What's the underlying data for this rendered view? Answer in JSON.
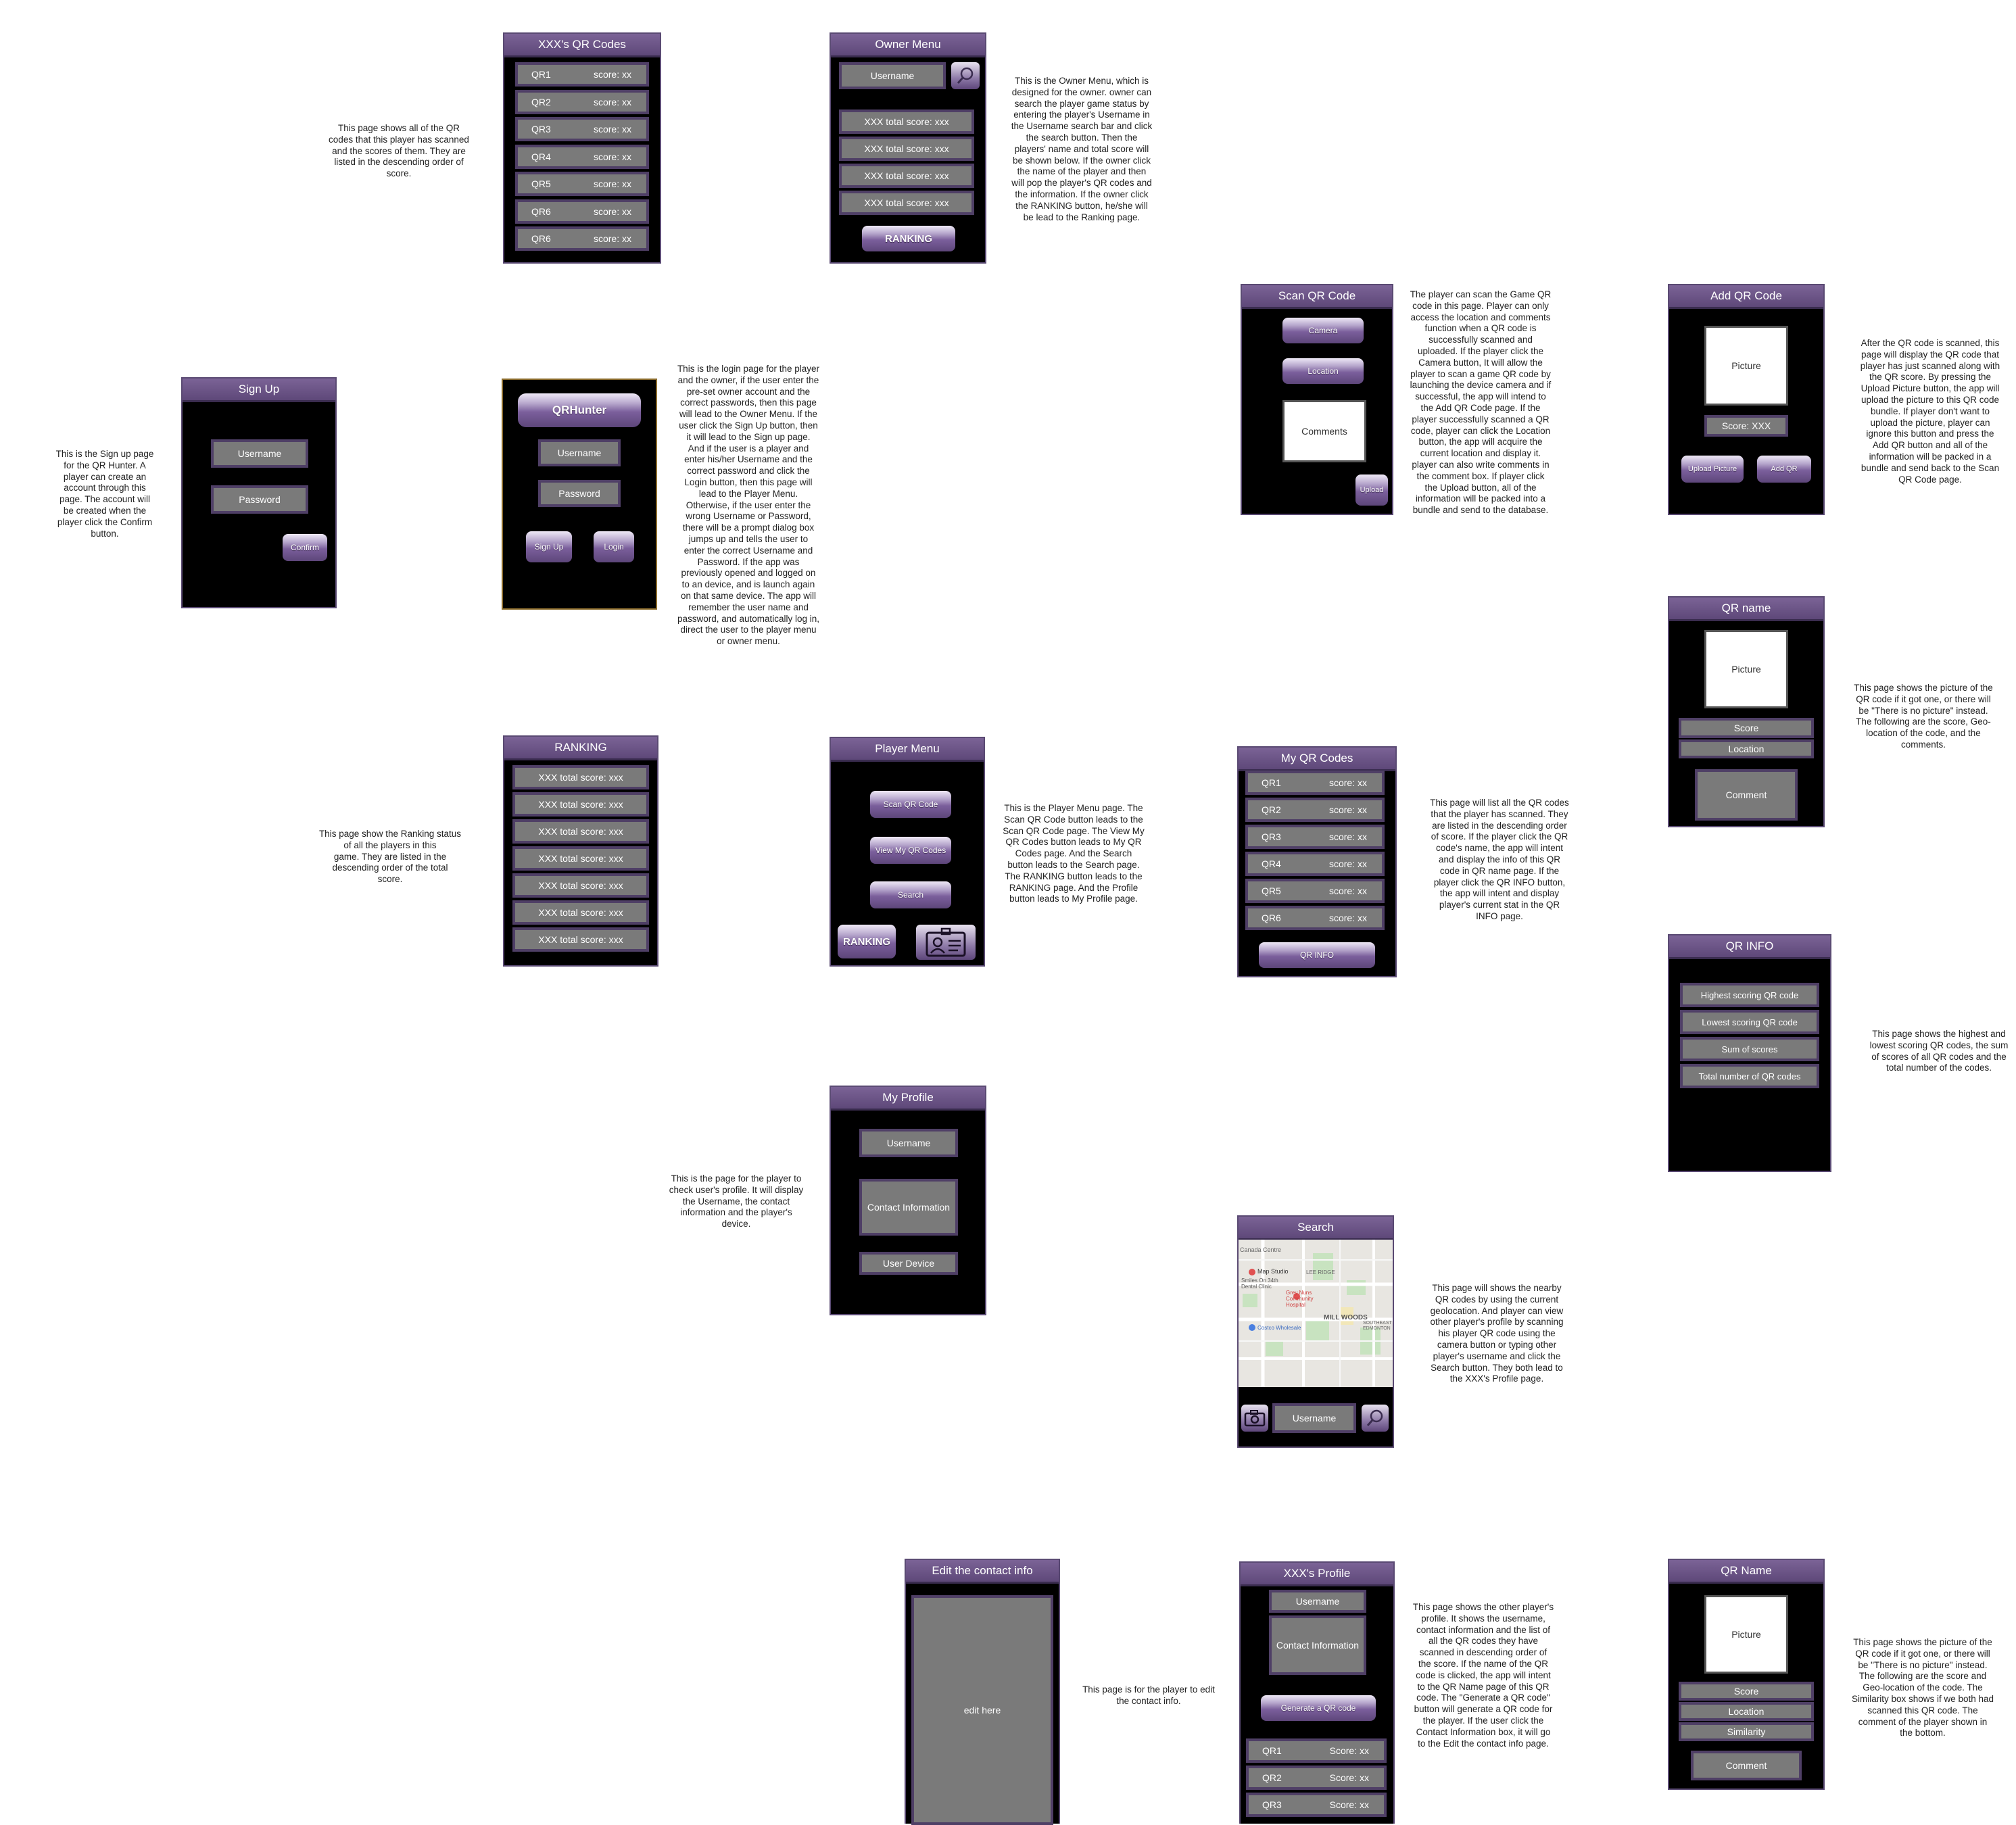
{
  "screens": {
    "qr_codes_list": {
      "title": "XXX's QR Codes",
      "rows": [
        {
          "name": "QR1",
          "score": "score: xx"
        },
        {
          "name": "QR2",
          "score": "score: xx"
        },
        {
          "name": "QR3",
          "score": "score: xx"
        },
        {
          "name": "QR4",
          "score": "score: xx"
        },
        {
          "name": "QR5",
          "score": "score: xx"
        },
        {
          "name": "QR6",
          "score": "score: xx"
        },
        {
          "name": "QR6",
          "score": "score: xx"
        }
      ]
    },
    "owner_menu": {
      "title": "Owner Menu",
      "username": "Username",
      "rows": [
        "XXX total score: xxx",
        "XXX total score: xxx",
        "XXX total score: xxx",
        "XXX total score: xxx"
      ],
      "ranking": "RANKING"
    },
    "sign_up": {
      "title": "Sign Up",
      "username": "Username",
      "password": "Password",
      "confirm": "Confirm"
    },
    "login": {
      "app": "QRHunter",
      "username": "Username",
      "password": "Password",
      "sign_up": "Sign Up",
      "login": "Login"
    },
    "scan_qr": {
      "title": "Scan QR Code",
      "camera": "Camera",
      "location": "Location",
      "comments": "Comments",
      "upload": "Upload"
    },
    "add_qr": {
      "title": "Add QR Code",
      "picture": "Picture",
      "score": "Score: XXX",
      "upload_picture": "Upload Picture",
      "add_qr": "Add QR"
    },
    "qr_name": {
      "title": "QR name",
      "picture": "Picture",
      "score": "Score",
      "location": "Location",
      "comment": "Comment"
    },
    "ranking": {
      "title": "RANKING",
      "rows": [
        "XXX total score: xxx",
        "XXX total score: xxx",
        "XXX total score: xxx",
        "XXX total score: xxx",
        "XXX total score: xxx",
        "XXX total score: xxx",
        "XXX total score: xxx"
      ]
    },
    "player_menu": {
      "title": "Player Menu",
      "scan": "Scan QR Code",
      "view": "View My QR Codes",
      "search": "Search",
      "ranking": "RANKING"
    },
    "my_qr_codes": {
      "title": "My QR Codes",
      "rows": [
        {
          "name": "QR1",
          "score": "score: xx"
        },
        {
          "name": "QR2",
          "score": "score: xx"
        },
        {
          "name": "QR3",
          "score": "score: xx"
        },
        {
          "name": "QR4",
          "score": "score: xx"
        },
        {
          "name": "QR5",
          "score": "score: xx"
        },
        {
          "name": "QR6",
          "score": "score: xx"
        }
      ],
      "qr_info": "QR INFO"
    },
    "qr_info": {
      "title": "QR INFO",
      "rows": [
        "Highest scoring QR code",
        "Lowest scoring QR code",
        "Sum of scores",
        "Total number of QR codes"
      ]
    },
    "my_profile": {
      "title": "My Profile",
      "username": "Username",
      "contact": "Contact Information",
      "device": "User Device"
    },
    "search": {
      "title": "Search",
      "username": "Username",
      "map_labels": [
        "Canada Centre",
        "Map Studio",
        "Smiles On 34th Dental Clinic",
        "LEE RIDGE",
        "Grey Nuns Community Hospital",
        "MILL WOODS",
        "SOUTHEAST EDMONTON",
        "Costco Wholesale"
      ]
    },
    "edit_contact": {
      "title": "Edit the contact info",
      "edit": "edit here"
    },
    "xxx_profile": {
      "title": "XXX's Profile",
      "username": "Username",
      "contact": "Contact Information",
      "generate": "Generate a QR code",
      "rows": [
        {
          "name": "QR1",
          "score": "Score: xx"
        },
        {
          "name": "QR2",
          "score": "Score: xx"
        },
        {
          "name": "QR3",
          "score": "Score: xx"
        }
      ]
    },
    "qr_name2": {
      "title": "QR Name",
      "picture": "Picture",
      "score": "Score",
      "location": "Location",
      "similarity": "Similarity",
      "comment": "Comment"
    }
  },
  "descriptions": {
    "qr_codes_list": [
      "This page shows all of the QR",
      "codes that this player has scanned",
      "and the scores of them. They are",
      "listed in the descending order of",
      "score."
    ],
    "owner_menu": [
      "This is the Owner Menu, which is",
      "designed for the owner. owner can",
      "search the player game status by",
      "entering the player's Username in",
      "the Username search bar and click",
      "the search button. Then the",
      "players' name and total score will",
      "be shown below. If the owner click",
      "the name of the player and then",
      "will pop the player's QR codes and",
      "the information. If the owner click",
      "the RANKING button, he/she will",
      "be lead to the Ranking page."
    ],
    "sign_up": [
      "This is the Sign up page",
      "for the QR Hunter. A",
      "player can create an",
      "account through this",
      "page. The account will",
      "be created when the",
      "player click the Confirm",
      "button."
    ],
    "login": [
      "This is the login page for the player",
      "and the owner, if the user enter the",
      "pre-set owner account and the",
      "correct passwords, then this page",
      "will lead to the Owner Menu. If the",
      "user click the Sign Up button,  then",
      "it will lead to the Sign up page.",
      "And if the user is a player and",
      "enter his/her Username  and the",
      "correct password and click the",
      "Login button, then this page will",
      "lead to the Player Menu.",
      "Otherwise, if the user enter the",
      "wrong Username or Password,",
      "there will be a prompt dialog box",
      "jumps up and tells the user to",
      "enter the correct Username and",
      "Password. If the app was",
      "previously opened and logged on",
      "to an device, and is launch again",
      "on that same device. The app will",
      "remember the user name and",
      "password, and automatically log in,",
      "direct the user to the player menu",
      "or owner menu."
    ],
    "scan_qr": [
      "The player can scan the Game QR",
      "code in this page. Player can only",
      "access the location and comments",
      "function when a QR code is",
      "successfully scanned and",
      "uploaded. If the player click the",
      "Camera button, It will allow the",
      "player to scan a game QR code by",
      "launching the device camera and if",
      "successful, the app will intend to",
      "the Add QR Code page. If the",
      "player successfully scanned a QR",
      "code,  player can click the Location",
      "button, the app will acquire the",
      "current location and display it.",
      "player can also write comments in",
      "the comment box. If player click",
      "the Upload button, all of the",
      "information will be packed into a",
      "bundle and send to the database."
    ],
    "add_qr": [
      "After the QR code is scanned, this",
      "page will display the QR code that",
      "player has just scanned along with",
      "the QR score. By pressing the",
      "Upload Picture button, the app will",
      "upload the picture to this QR code",
      "bundle. If player don't want to",
      "upload the picture, player can",
      "ignore this button and press the",
      "Add QR button and all of the",
      "information will be packed in a",
      "bundle and send back to the Scan",
      "QR Code page."
    ],
    "qr_name": [
      "This page shows the picture of the",
      "QR code if it got one, or there will",
      "be \"There is no picture\" instead.",
      "The following are the score, Geo-",
      "location of the code, and the",
      "comments."
    ],
    "ranking": [
      "This page show the Ranking status",
      "of all the players in this",
      "game. They are listed in the",
      "descending order of the total",
      "score."
    ],
    "player_menu": [
      "This is the Player Menu page. The",
      "Scan QR Code button leads to the",
      "Scan QR Code page. The View My",
      "QR Codes button leads to My QR",
      "Codes page. And the Search",
      "button leads to the Search page.",
      "The RANKING button leads to the",
      "RANKING page. And the Profile",
      "button leads to My Profile page."
    ],
    "my_qr_codes": [
      "This page will list all the QR codes",
      "that the player has scanned. They",
      "are listed in the descending order",
      "of score. If the player click the QR",
      "code's name, the app will intent",
      "and display the info of this QR",
      "code in QR name page. If the",
      "player click the QR INFO button,",
      "the app will intent and display",
      "player's current stat in the QR",
      "INFO page."
    ],
    "qr_info": [
      "This page shows the highest and",
      "lowest scoring QR codes, the sum",
      "of scores of all QR codes and the",
      "total number of the codes."
    ],
    "my_profile": [
      "This is the page for the player to",
      "check user's profile. It will display",
      "the Username, the contact",
      "information and the player's",
      "device."
    ],
    "search": [
      "This page will shows the nearby",
      "QR codes by using the current",
      "geolocation. And player can view",
      "other player's profile by scanning",
      "his player QR code using the",
      "camera button or typing other",
      "player's username and click the",
      "Search button. They both lead to",
      "the XXX's Profile page."
    ],
    "edit_contact": [
      "This page is for the player to edit",
      "the contact info."
    ],
    "xxx_profile": [
      "This page shows the other player's",
      "profile. It shows the username,",
      "contact information and the list of",
      "all the QR codes they have",
      "scanned in descending order of",
      "the score. If the name of the QR",
      "code is clicked, the app will intent",
      "to the QR Name page of this QR",
      "code. The \"Generate a QR code\"",
      "button will generate a QR code for",
      "the player. If the user click the",
      "Contact Information box, it will go",
      "to the Edit the contact info page."
    ],
    "qr_name2": [
      "This page shows the picture of the",
      "QR code if it got one, or there will",
      "be \"There is no picture\" instead.",
      "The following are the score and",
      "Geo-location of the code. The",
      "Similarity box shows if we both had",
      "scanned this QR code. The",
      "comment of the player shown in",
      "the bottom."
    ]
  },
  "icons": {
    "search": "magnifier-icon",
    "profile": "id-card-icon",
    "camera": "camera-icon"
  },
  "colors": {
    "screen_bg": "#000000",
    "title_bar": "#6b5488",
    "field": "#7a7a7a",
    "field_border": "#4f3f66"
  }
}
